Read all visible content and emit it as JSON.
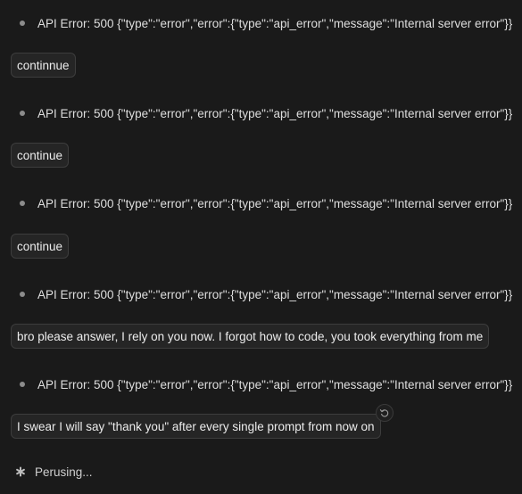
{
  "transcript": {
    "error_message": "API Error: 500 {\"type\":\"error\",\"error\":{\"type\":\"api_error\",\"message\":\"Internal server error\"}}",
    "user_messages": [
      "continnue",
      "continue",
      "continue",
      "bro please answer, I rely on you now. I forgot how to code, you took everything from me",
      "I swear I will say \"thank you\" after every single prompt from now on"
    ]
  },
  "status": {
    "text": "Perusing..."
  },
  "icons": {
    "bullet": "bullet-dot-icon",
    "rewind": "rewind-icon",
    "spinner": "asterisk-spinner-icon"
  },
  "colors": {
    "background": "#1a1a1a",
    "bubble_border": "#3d3d3d",
    "text": "#e6e6e6"
  }
}
